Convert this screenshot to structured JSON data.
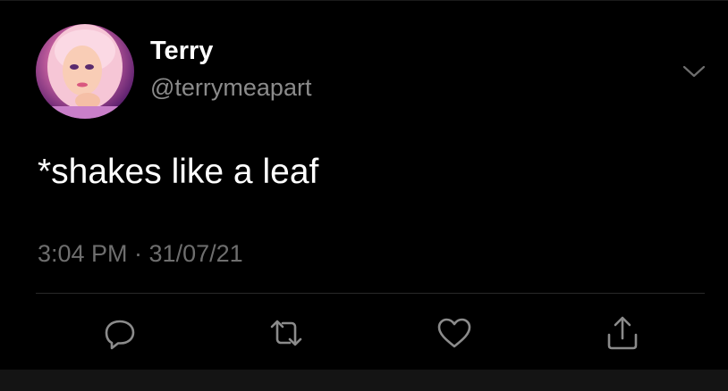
{
  "tweet": {
    "author": {
      "display_name": "Terry",
      "handle": "@terrymeapart",
      "avatar_icon": "avatar-image"
    },
    "text": "*shakes like a leaf",
    "timestamp": "3:04 PM · 31/07/21",
    "menu_icon": "chevron-down-icon"
  },
  "actions": [
    {
      "name": "reply",
      "icon": "reply-icon"
    },
    {
      "name": "retweet",
      "icon": "retweet-icon"
    },
    {
      "name": "like",
      "icon": "heart-icon"
    },
    {
      "name": "share",
      "icon": "share-icon"
    }
  ],
  "colors": {
    "background": "#000000",
    "primary_text": "#ffffff",
    "secondary_text": "#8b8b8b",
    "timestamp_text": "#6e6e6e",
    "divider": "#2a2a2a",
    "icon": "#8b8b8b",
    "bottom_strip": "#141414"
  }
}
